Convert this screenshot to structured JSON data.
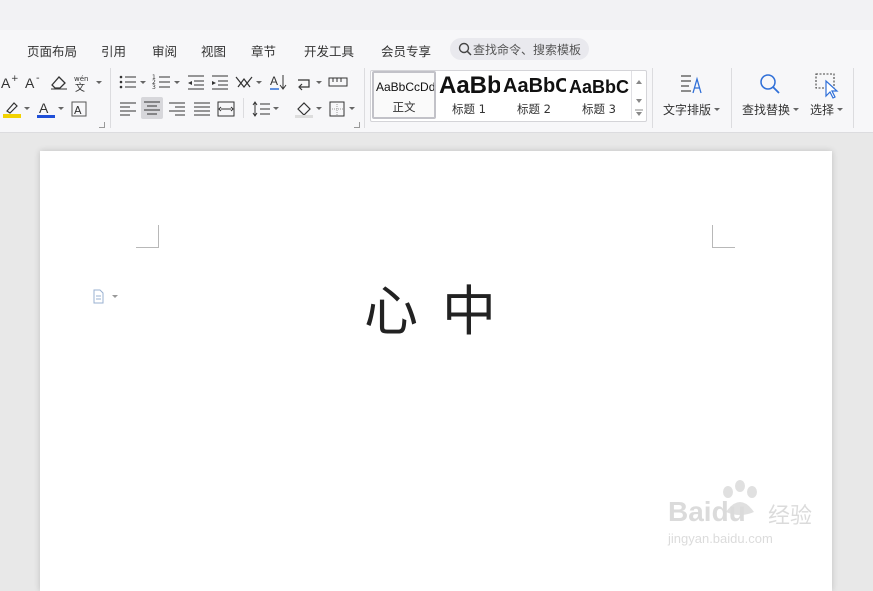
{
  "menu": {
    "items": [
      "页面布局",
      "引用",
      "审阅",
      "视图",
      "章节",
      "开发工具",
      "会员专享"
    ],
    "search_placeholder": "查找命令、搜索模板"
  },
  "styles": [
    {
      "preview": "AaBbCcDd",
      "name": "正文"
    },
    {
      "preview": "AaBb",
      "name": "标题 1"
    },
    {
      "preview": "AaBbC",
      "name": "标题 2"
    },
    {
      "preview": "AaBbC",
      "name": "标题 3"
    }
  ],
  "buttons": {
    "text_layout": "文字排版",
    "find_replace": "查找替换",
    "select": "选择"
  },
  "document": {
    "text": "心中"
  },
  "watermark": {
    "brand": "Baidu",
    "brand_cn": "经验",
    "url": "jingyan.baidu.com"
  },
  "colors": {
    "highlight": "#f2d200",
    "font_color": "#1f4fd8",
    "accent": "#2f6fd8"
  }
}
